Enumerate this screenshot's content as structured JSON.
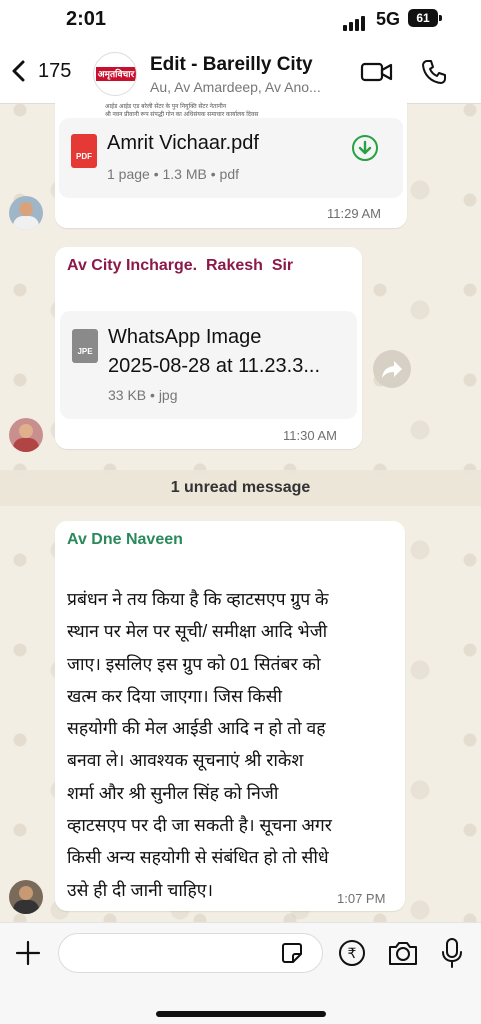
{
  "status_bar": {
    "time": "2:01",
    "network": "5G",
    "battery": "61"
  },
  "header": {
    "back_count": "175",
    "group_title": "Edit - Bareilly City",
    "group_members": "Au, Av Amardeep, Av Ano...",
    "avatar_logo_text": "अमृतविचार"
  },
  "messages": {
    "pdf": {
      "preview_text_1": "आईड आईड एड बरेली सेंटर के पुन नियुक्ति सेंटर नेतानीन",
      "preview_text_2": "श्री नवन प्रीवानी रूप संपद्धी गोन का अधिसंयक समाचार कार्यालय दिवस",
      "file_icon_label": "PDF",
      "file_name": "Amrit Vichaar.pdf",
      "file_meta": "1 page • 1.3 MB • pdf",
      "time": "11:29 AM"
    },
    "image_doc": {
      "sender": "Av City Incharge.  Rakesh  Sir",
      "file_icon_label": "JPE",
      "file_name_line1": "WhatsApp Image",
      "file_name_line2": "2025-08-28 at 11.23.3...",
      "file_meta": "33 KB • jpg",
      "time": "11:30 AM"
    },
    "unread_banner": "1 unread message",
    "text_msg": {
      "sender": "Av Dne Naveen",
      "lines": [
        "प्रबंधन ने तय किया है कि व्हाटसएप ग्रुप के",
        "स्थान पर मेल पर सूची/ समीक्षा आदि भेजी",
        "जाए। इसलिए इस ग्रुप को 01 सितंबर को",
        "खत्म कर दिया जाएगा। जिस किसी",
        "सहयोगी की मेल आईडी आदि न हो तो वह",
        "बनवा ले। आवश्यक सूचनाएं श्री राकेश",
        "शर्मा और श्री सुनील सिंह को निजी",
        "व्हाटसएप पर दी जा सकती है। सूचना अगर",
        "किसी अन्य सहयोगी से संबंधित हो तो सीधे",
        "उसे ही दी जानी चाहिए।"
      ],
      "time": "1:07 PM"
    }
  },
  "composer": {
    "value": "",
    "placeholder": ""
  },
  "colors": {
    "accent_green": "#25a244",
    "sender_maroon": "#8b1a4a",
    "pdf_red": "#e53935"
  }
}
